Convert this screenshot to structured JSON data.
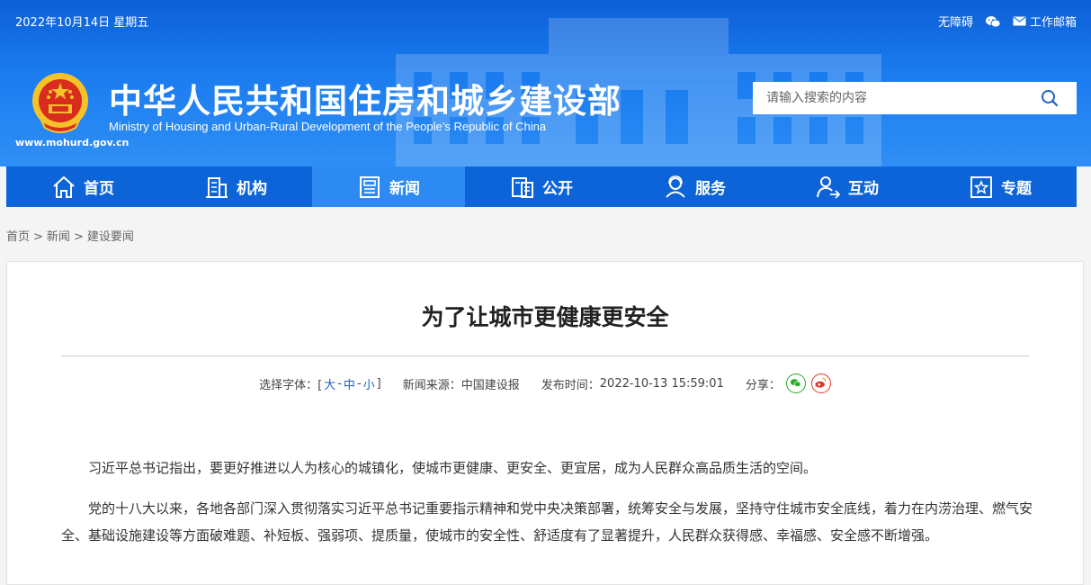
{
  "topbar": {
    "date": "2022年10月14日 星期五",
    "accessibility": "无障碍",
    "wechat_icon": "wechat-icon",
    "mail_icon": "mail-icon",
    "mail_label": "工作邮箱"
  },
  "site": {
    "title_cn": "中华人民共和国住房和城乡建设部",
    "title_en": "Ministry of Housing and Urban-Rural Development of the People’s Republic of China",
    "url": "www.mohurd.gov.cn"
  },
  "search": {
    "placeholder": "请输入搜索的内容"
  },
  "nav": {
    "items": [
      {
        "label": "首页",
        "icon": "home-icon"
      },
      {
        "label": "机构",
        "icon": "building-icon"
      },
      {
        "label": "新闻",
        "icon": "news-icon"
      },
      {
        "label": "公开",
        "icon": "document-icon"
      },
      {
        "label": "服务",
        "icon": "service-icon"
      },
      {
        "label": "互动",
        "icon": "interaction-icon"
      },
      {
        "label": "专题",
        "icon": "topic-icon"
      }
    ],
    "active_index": 2
  },
  "breadcrumb": {
    "home": "首页",
    "sep": ">",
    "news": "新闻",
    "current": "建设要闻"
  },
  "article": {
    "title": "为了让城市更健康更安全",
    "font_label": "选择字体：[",
    "font_large": "大",
    "font_medium": "中",
    "font_small": "小",
    "font_dash": "-",
    "font_end": "]",
    "source_label": "新闻来源：",
    "source": "中国建设报",
    "time_label": "发布时间：",
    "time": "2022-10-13 15:59:01",
    "share_label": "分享：",
    "paragraphs": [
      "习近平总书记指出，要更好推进以人为核心的城镇化，使城市更健康、更安全、更宜居，成为人民群众高品质生活的空间。",
      "党的十八大以来，各地各部门深入贯彻落实习近平总书记重要指示精神和党中央决策部署，统筹安全与发展，坚持守住城市安全底线，着力在内涝治理、燃气安全、基础设施建设等方面破难题、补短板、强弱项、提质量，使城市的安全性、舒适度有了显著提升，人民群众获得感、幸福感、安全感不断增强。"
    ]
  },
  "colors": {
    "header_blue": "#1b7cf0",
    "nav_blue": "#0c64d8",
    "nav_active": "#2d8af2",
    "link_blue": "#1b63c9"
  }
}
